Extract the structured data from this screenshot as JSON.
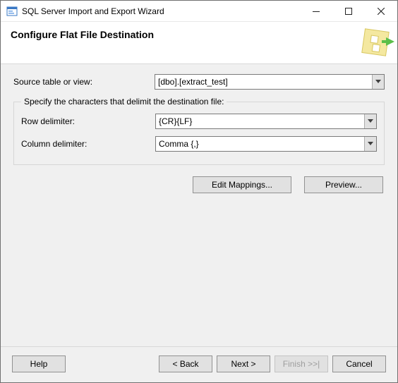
{
  "window": {
    "title": "SQL Server Import and Export Wizard"
  },
  "header": {
    "heading": "Configure Flat File Destination"
  },
  "source": {
    "label": "Source table or view:",
    "value": "[dbo].[extract_test]"
  },
  "delimiters": {
    "legend": "Specify the characters that delimit the destination file:",
    "row": {
      "label": "Row delimiter:",
      "value": "{CR}{LF}"
    },
    "column": {
      "label": "Column delimiter:",
      "value": "Comma {,}"
    }
  },
  "actions": {
    "edit_mappings": "Edit Mappings...",
    "preview": "Preview..."
  },
  "footer": {
    "help": "Help",
    "back": "< Back",
    "next": "Next >",
    "finish": "Finish >>|",
    "cancel": "Cancel"
  }
}
